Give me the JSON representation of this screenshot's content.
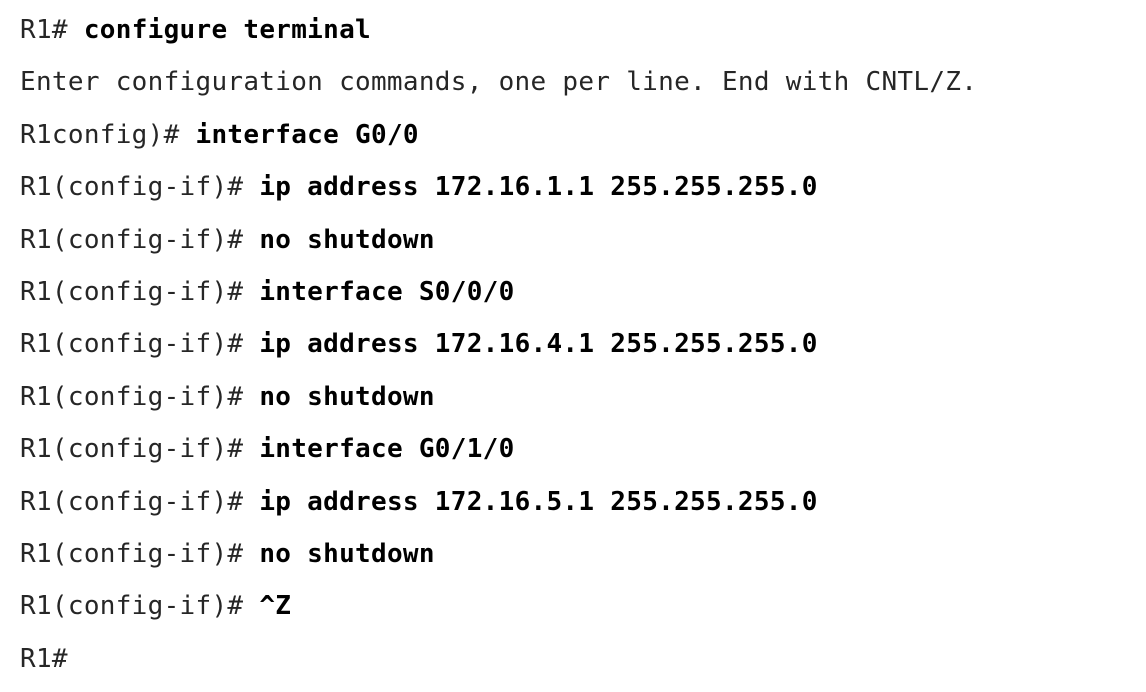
{
  "lines": [
    {
      "prompt": "R1# ",
      "command": "configure terminal"
    },
    {
      "prompt": "Enter configuration commands, one per line. End with CNTL/Z.",
      "command": ""
    },
    {
      "prompt": "R1config)# ",
      "command": "interface G0/0"
    },
    {
      "prompt": "R1(config-if)# ",
      "command": "ip address 172.16.1.1 255.255.255.0"
    },
    {
      "prompt": "R1(config-if)# ",
      "command": "no shutdown"
    },
    {
      "prompt": "R1(config-if)# ",
      "command": "interface S0/0/0"
    },
    {
      "prompt": "R1(config-if)# ",
      "command": "ip address 172.16.4.1 255.255.255.0"
    },
    {
      "prompt": "R1(config-if)# ",
      "command": "no shutdown"
    },
    {
      "prompt": "R1(config-if)# ",
      "command": "interface G0/1/0"
    },
    {
      "prompt": "R1(config-if)# ",
      "command": "ip address 172.16.5.1 255.255.255.0"
    },
    {
      "prompt": "R1(config-if)# ",
      "command": "no shutdown"
    },
    {
      "prompt": "R1(config-if)# ",
      "command": "^Z"
    },
    {
      "prompt": "R1#",
      "command": ""
    }
  ]
}
